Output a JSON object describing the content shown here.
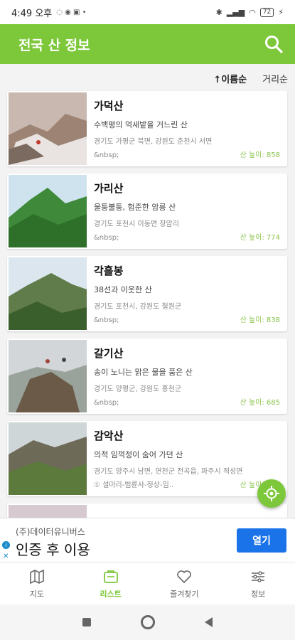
{
  "status_bar": {
    "time": "4:49 오후",
    "battery": "72"
  },
  "app_bar": {
    "title": "전국 산 정보"
  },
  "sort": {
    "name_label": "↑이름순",
    "height_label": "거리순"
  },
  "mountains": [
    {
      "name": "가덕산",
      "desc": "수백평의 억새밭을 거느린 산",
      "addr": "경기도 가평군 북면, 강원도 춘천시 서면",
      "extra": "&nbsp;",
      "height": "산 높이: 858"
    },
    {
      "name": "가리산",
      "desc": "울퉁불퉁, 험준한 암릉 산",
      "addr": "경기도 포천시 이동면 장암리",
      "extra": "&nbsp;",
      "height": "산 높이: 774"
    },
    {
      "name": "각흘봉",
      "desc": "38선과 이웃한 산",
      "addr": "경기도 포천시, 강원도 철원군",
      "extra": "&nbsp;",
      "height": "산 높이: 838"
    },
    {
      "name": "갈기산",
      "desc": "송이 노니는 맑은 물을 품은 산",
      "addr": "경기도 양평군, 강원도 홍천군",
      "extra": "&nbsp;",
      "height": "산 높이: 685"
    },
    {
      "name": "감악산",
      "desc": "의적 임꺽정이 숨어 가던 산",
      "addr": "경기도 양주시 남면, 연천군 전곡읍, 파주시 적성면",
      "extra": "① 설마리-범륜사-정상-임..",
      "height": "산 높이: 675"
    }
  ],
  "ad": {
    "company": "(주)데이터유니버스",
    "tagline": "인증 후 이용",
    "open_label": "열기"
  },
  "bottom_nav": [
    {
      "label": "지도",
      "icon": "map-icon"
    },
    {
      "label": "리스트",
      "icon": "list-icon"
    },
    {
      "label": "즐겨찾기",
      "icon": "heart-icon"
    },
    {
      "label": "정보",
      "icon": "settings-icon"
    }
  ],
  "colors": {
    "accent": "#7dc83a",
    "height_text": "#8bc34a",
    "ad_button": "#1a73e8"
  }
}
